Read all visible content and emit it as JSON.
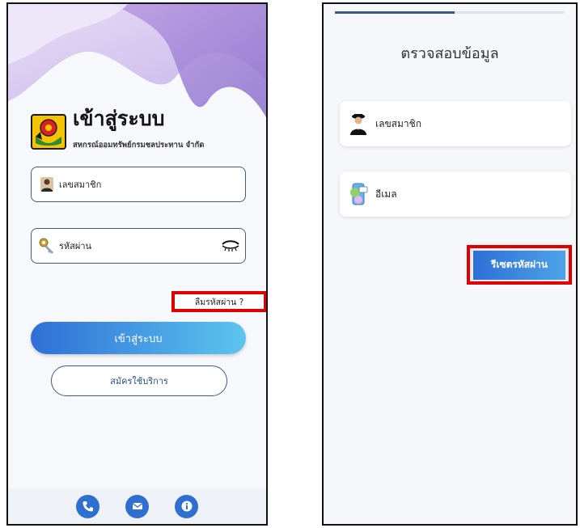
{
  "login": {
    "title": "เข้าสู่ระบบ",
    "subtitle": "สหกรณ์ออมทรัพย์กรมชลประทาน จำกัด",
    "member_label": "เลขสมาชิก",
    "password_label": "รหัสผ่าน",
    "forgot_label": "ลืมรหัสผ่าน ?",
    "login_button": "เข้าสู่ระบบ",
    "register_button": "สมัครใช้บริการ",
    "bottom_icons": [
      "phone-icon",
      "mail-icon",
      "info-icon"
    ]
  },
  "verify": {
    "progress": 0.52,
    "title": "ตรวจสอบข้อมูล",
    "member_label": "เลขสมาชิก",
    "email_label": "อีเมล",
    "reset_button": "รีเซตรหัสผ่าน"
  },
  "colors": {
    "accent": "#2f6fd6",
    "highlight_border": "#e00000",
    "logo_yellow": "#f5c400"
  }
}
